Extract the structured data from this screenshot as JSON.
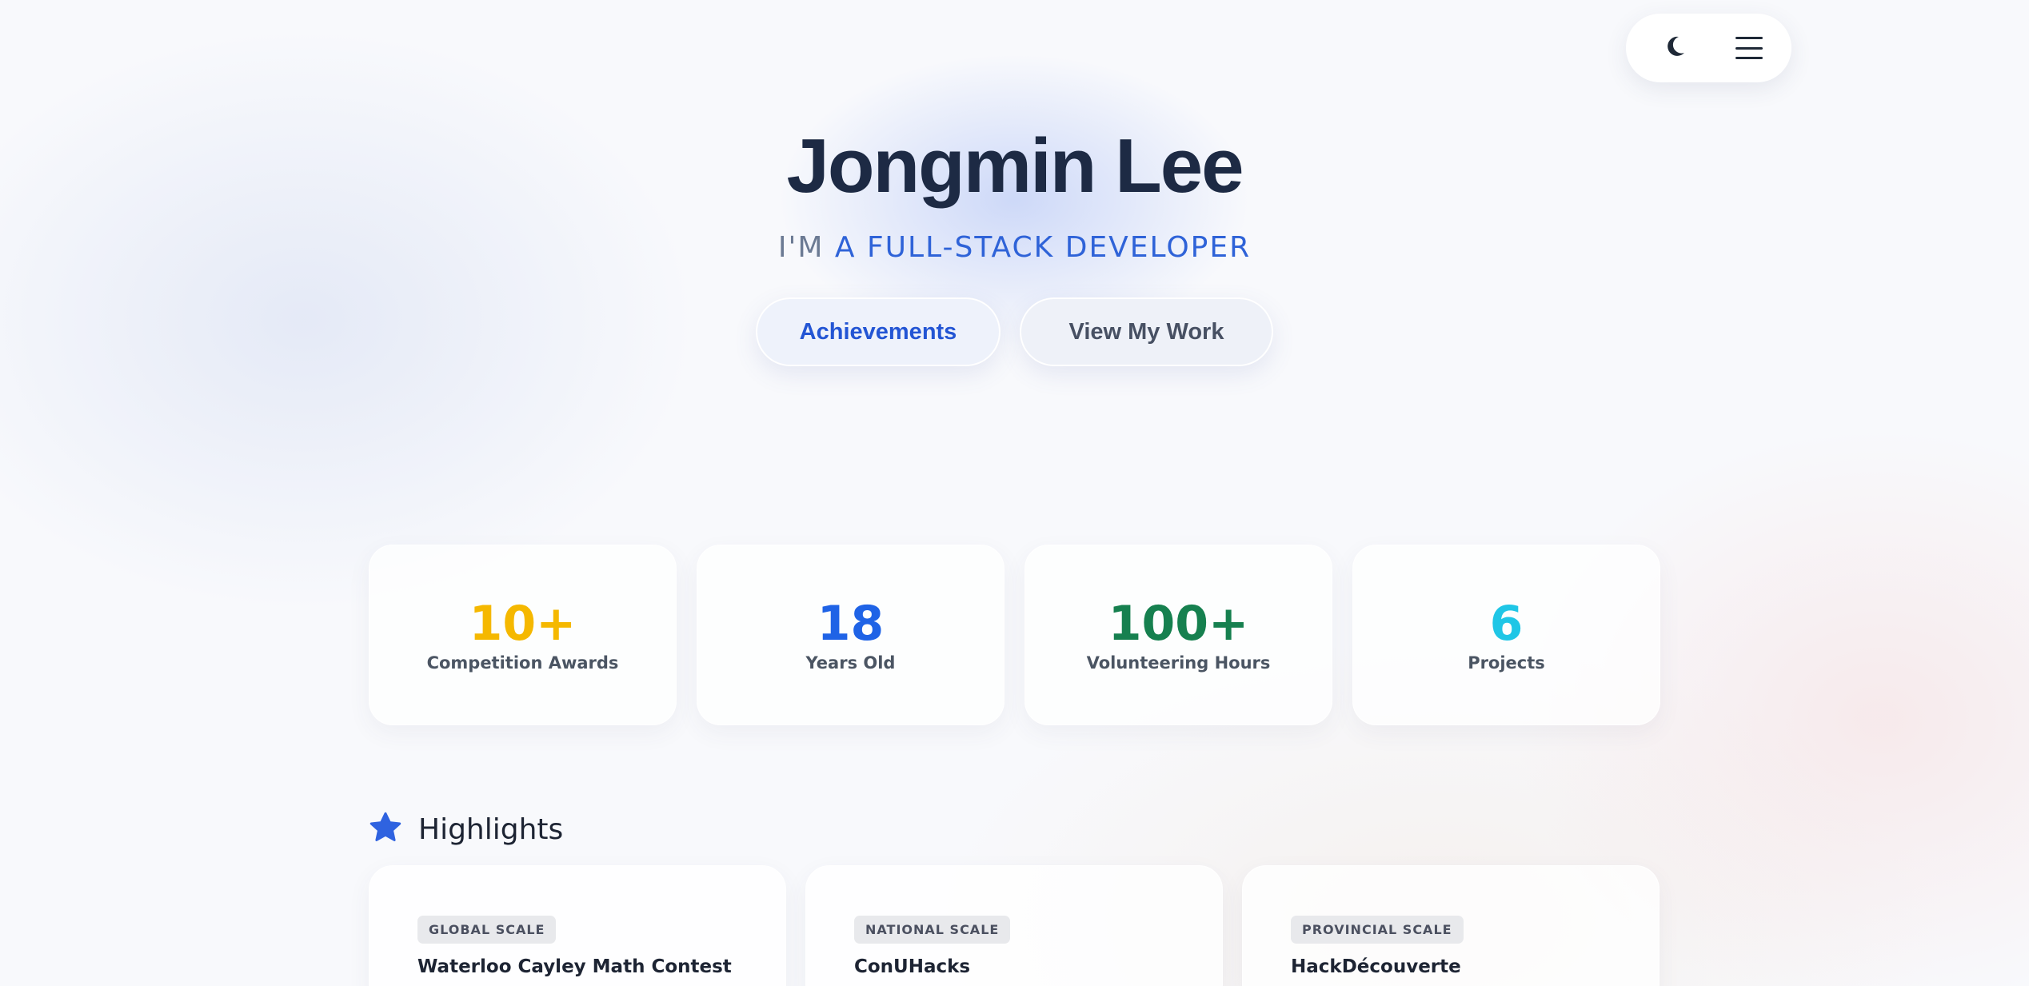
{
  "nav": {
    "theme_toggle_icon": "moon-icon",
    "menu_icon": "hamburger-menu-icon"
  },
  "hero": {
    "name": "Jongmin Lee",
    "subtitle_prefix": "I'M ",
    "subtitle_role": "A FULL-STACK DEVELOPER",
    "buttons": [
      {
        "label": "Achievements"
      },
      {
        "label": "View My Work"
      }
    ]
  },
  "stats": [
    {
      "value": "10+",
      "label": "Competition Awards",
      "color": "#f5b800"
    },
    {
      "value": "18",
      "label": "Years Old",
      "color": "#1f63e6"
    },
    {
      "value": "100+",
      "label": "Volunteering Hours",
      "color": "#16804f"
    },
    {
      "value": "6",
      "label": "Projects",
      "color": "#1fc6e6"
    }
  ],
  "highlights": {
    "icon": "star-icon",
    "title": "Highlights",
    "accent_color": "#2f63e0",
    "items": [
      {
        "scale": "GLOBAL SCALE",
        "title": "Waterloo Cayley Math Contest"
      },
      {
        "scale": "NATIONAL SCALE",
        "title": "ConUHacks"
      },
      {
        "scale": "PROVINCIAL SCALE",
        "title": "HackDécouverte"
      }
    ]
  }
}
